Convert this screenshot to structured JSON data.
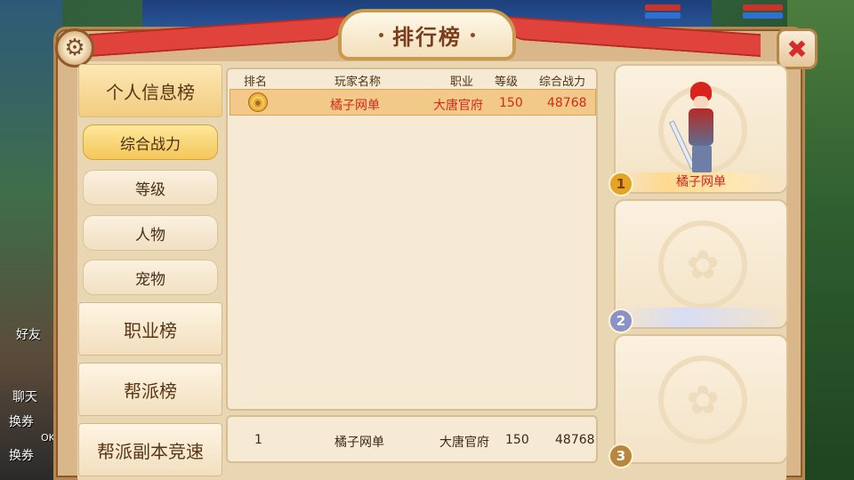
{
  "window": {
    "title": "排行榜"
  },
  "side_labels": {
    "friend": "好友",
    "chat": "聊天",
    "exchange1": "换券",
    "exchange2": "换券",
    "ok": "OK"
  },
  "menu": {
    "personal": "个人信息榜",
    "sub_items": [
      "综合战力",
      "等级",
      "人物",
      "宠物"
    ],
    "profession": "职业榜",
    "guild": "帮派榜",
    "guild_dungeon": "帮派副本竞速"
  },
  "table": {
    "columns": [
      "排名",
      "玩家名称",
      "职业",
      "等级",
      "综合战力"
    ],
    "rows": [
      {
        "player": "橘子网单",
        "profession": "大唐官府",
        "level": "150",
        "power": "48768"
      }
    ]
  },
  "my_rank": {
    "rank": "1",
    "player": "橘子网单",
    "profession": "大唐官府",
    "level": "150",
    "power": "48768"
  },
  "top3": [
    {
      "rank": "1",
      "name": "橘子网单"
    },
    {
      "rank": "2",
      "name": ""
    },
    {
      "rank": "3",
      "name": ""
    }
  ],
  "icons": {
    "settings": "gear-icon",
    "close": "close-icon",
    "medal": "gold-medal-icon"
  },
  "colors": {
    "highlight_text": "#d22a1c",
    "ribbon": "#e0433b",
    "active_tab": "#f4c75a"
  }
}
